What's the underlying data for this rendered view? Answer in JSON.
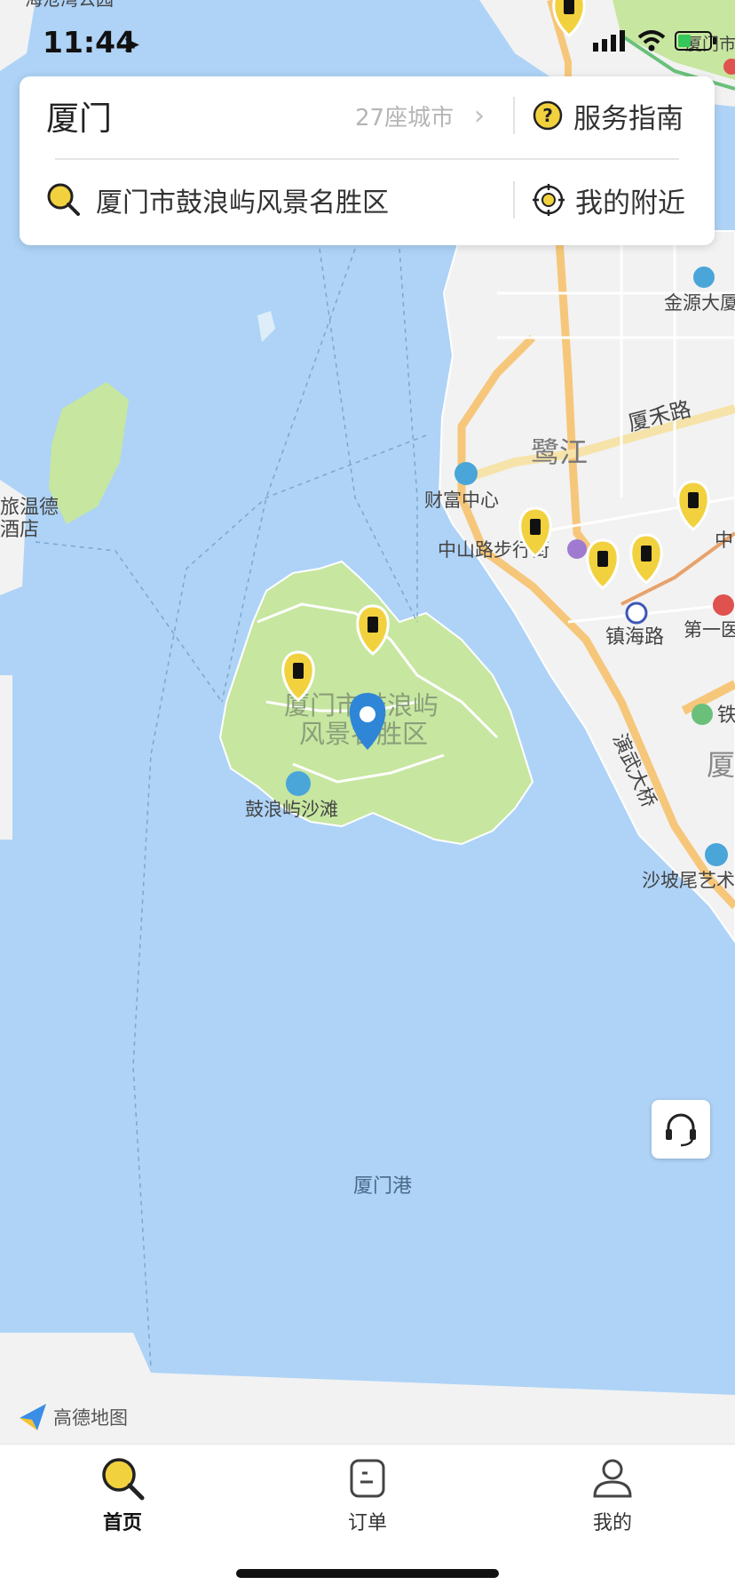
{
  "status_bar": {
    "time": "11:44"
  },
  "header": {
    "city": "厦门",
    "city_count": "27座城市",
    "service_guide": "服务指南",
    "search_value": "厦门市鼓浪屿风景名胜区",
    "nearby": "我的附近"
  },
  "map": {
    "labels": {
      "hotel_1": "旅温德",
      "hotel_2": "酒店",
      "jinyuan": "金源大厦",
      "xiahe_road": "厦禾路",
      "lujiang": "鹭江",
      "caifu": "财富中心",
      "zhongshan": "中山路步行街",
      "zhong_cut": "中",
      "zhenhai": "镇海路",
      "diyi": "第一医",
      "tie": "铁",
      "xia": "厦",
      "yanwu": "演武大桥",
      "shapowei": "沙坡尾艺术",
      "gulangyu_1": "厦门市鼓浪屿",
      "gulangyu_2": "风景名胜区",
      "beach": "鼓浪屿沙滩",
      "harbor": "厦门港",
      "top_park": "海沧湾公园",
      "top_right": "厦门市"
    },
    "logo_text": "高德地图",
    "colors": {
      "water": "#aed3f7",
      "land": "#f3f3f3",
      "park": "#c7e6a0",
      "road": "#f6c77a",
      "pin": "#f2d13f",
      "location": "#2f86d6"
    }
  },
  "tabbar": {
    "tabs": [
      {
        "label": "首页",
        "icon": "search-icon",
        "active": true
      },
      {
        "label": "订单",
        "icon": "order-icon",
        "active": false
      },
      {
        "label": "我的",
        "icon": "profile-icon",
        "active": false
      }
    ]
  }
}
